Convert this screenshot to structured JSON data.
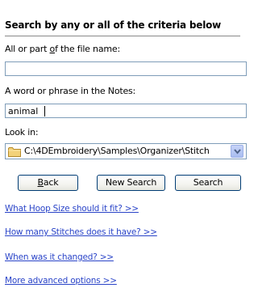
{
  "header": {
    "title": "Search by any or all of the criteria below"
  },
  "filename": {
    "label_pre": "All or part ",
    "label_u": "o",
    "label_post": "f the file name:",
    "value": ""
  },
  "notes": {
    "label": "A word or phrase in the Notes:",
    "value": "animal"
  },
  "look_in": {
    "label": "Look in:",
    "value": "C:\\4DEmbroidery\\Samples\\Organizer\\Stitch"
  },
  "buttons": {
    "back_u": "B",
    "back_rest": "ack",
    "new_search": "New Search",
    "search": "Search"
  },
  "links": {
    "hoop": "What Hoop Size should it fit? >>",
    "stitches": "How many Stitches does it have? >>",
    "changed": "When was it changed? >>",
    "advanced": "More advanced options >>"
  },
  "colors": {
    "link": "#2a44c8",
    "field_border": "#7f9db9",
    "button_border": "#003c74"
  }
}
